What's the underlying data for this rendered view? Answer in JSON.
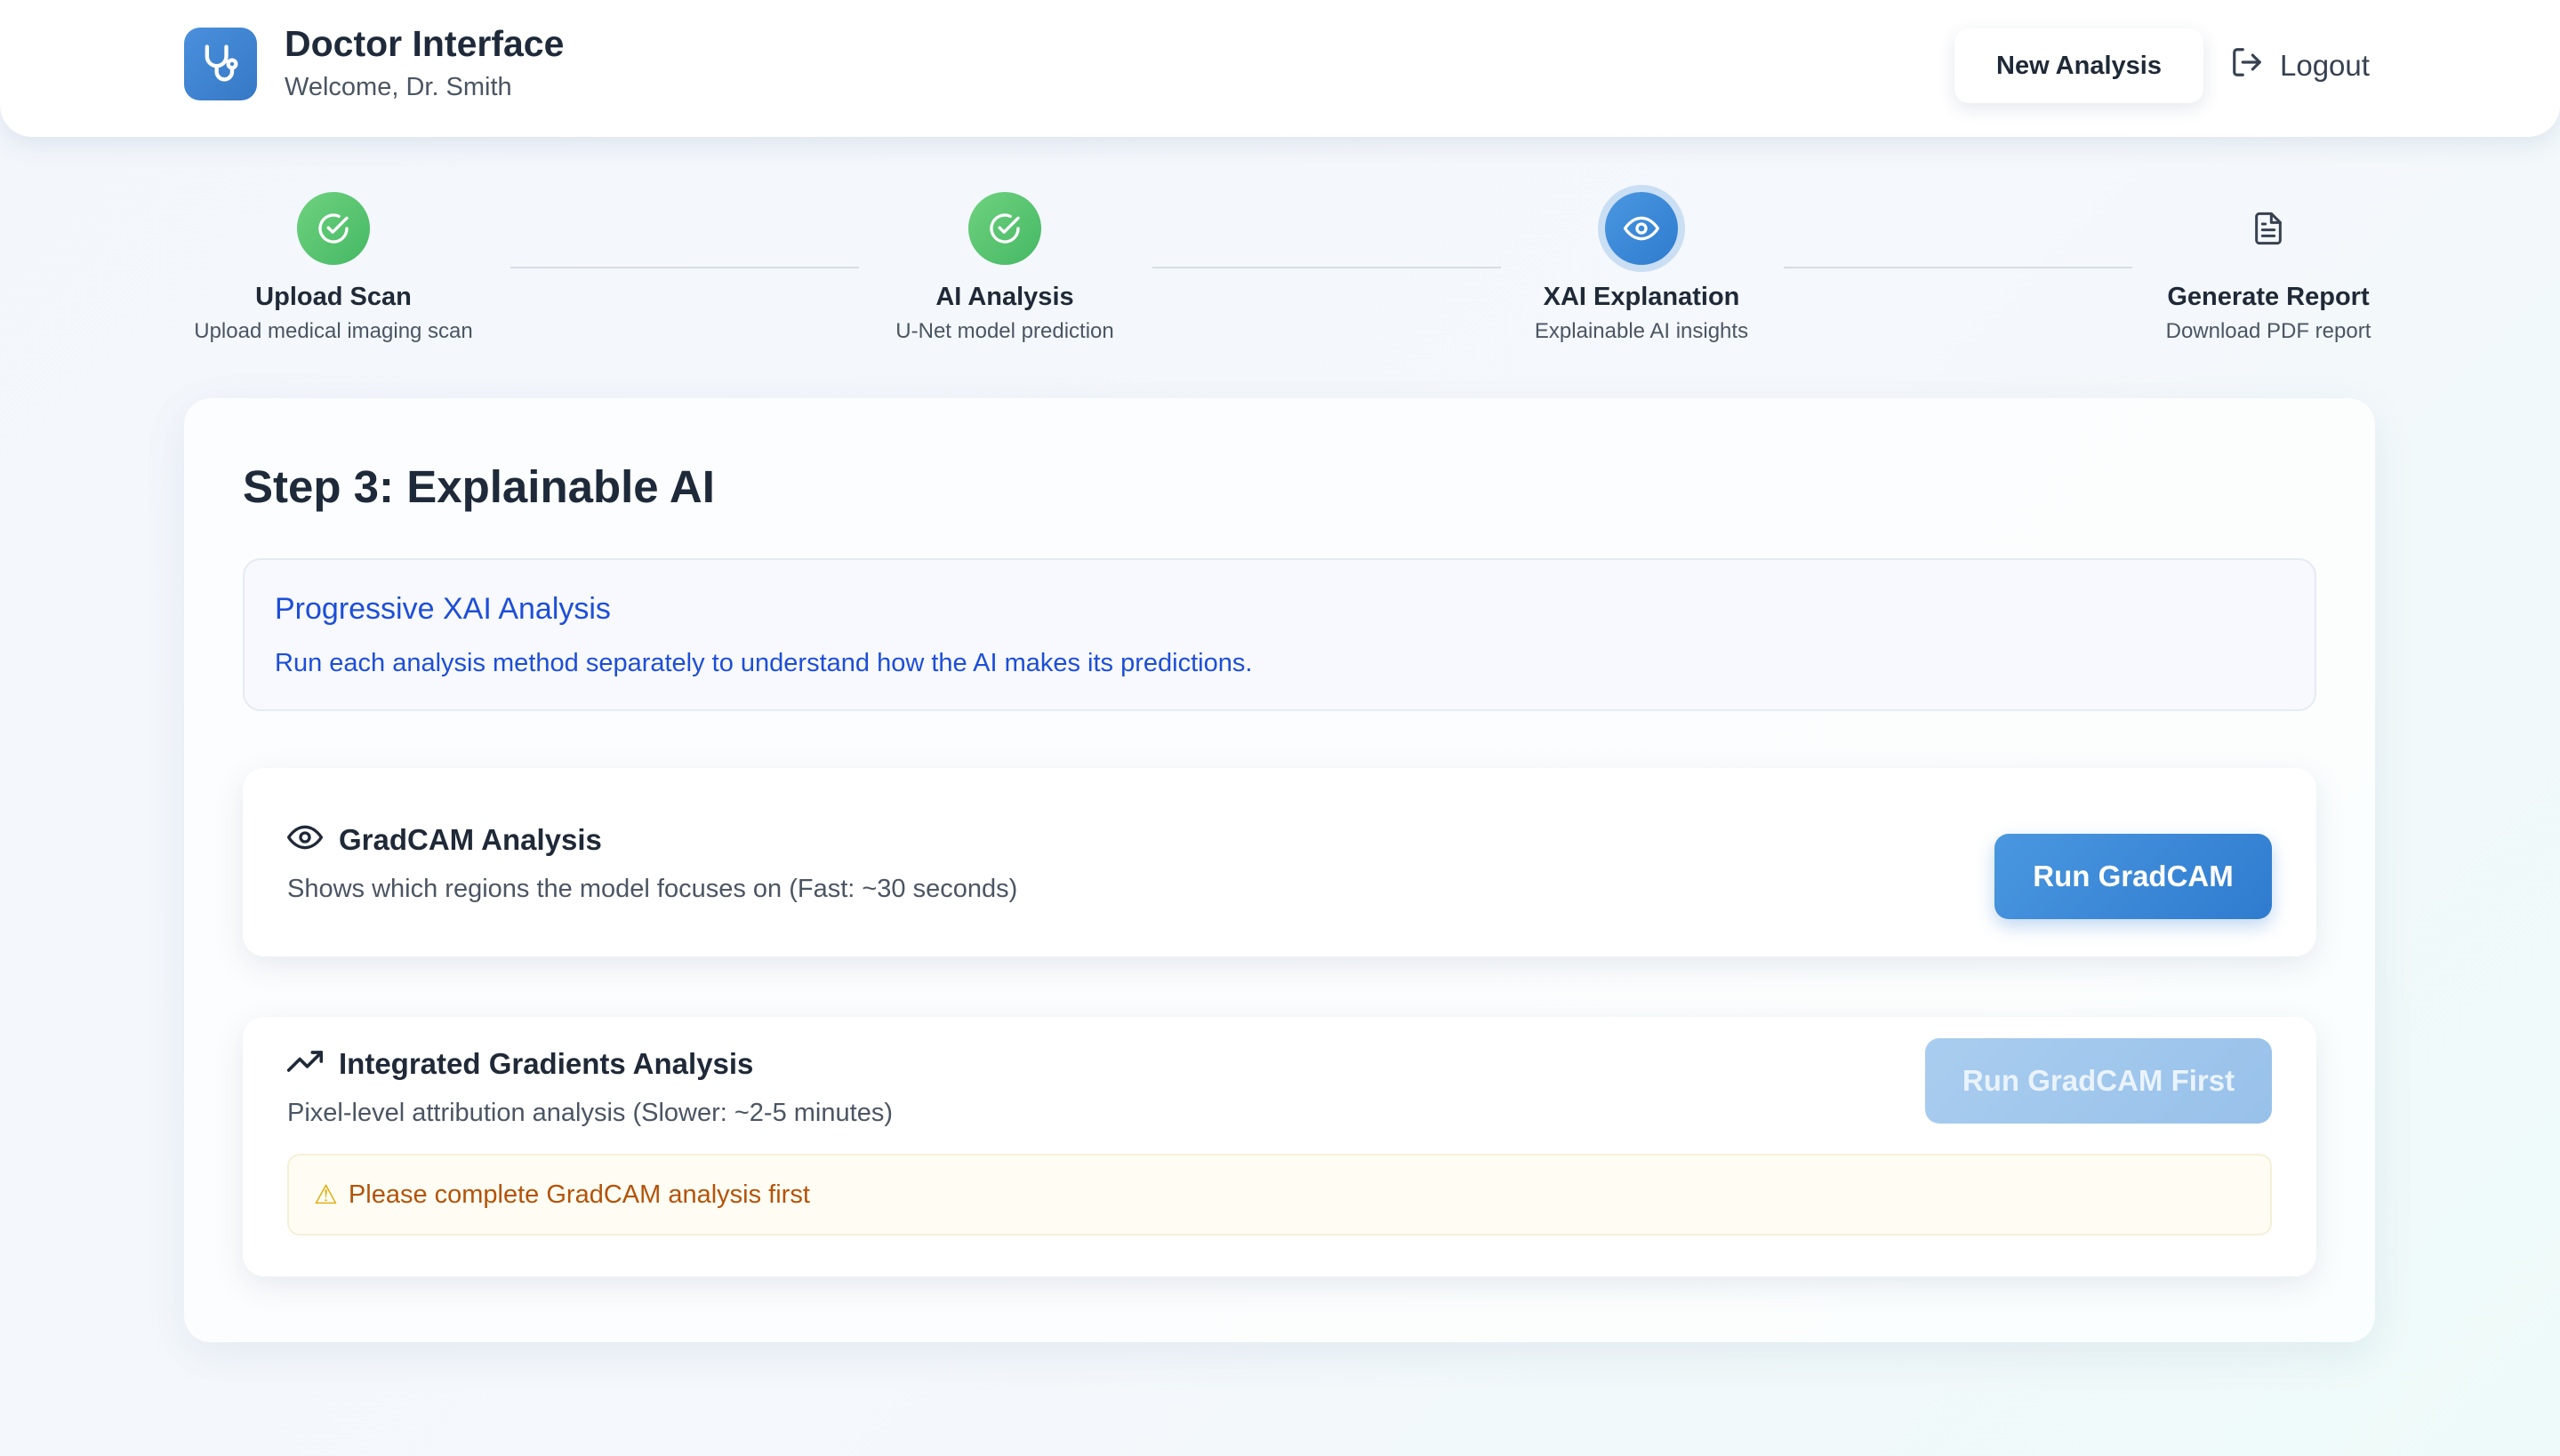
{
  "header": {
    "title": "Doctor Interface",
    "subtitle": "Welcome, Dr. Smith",
    "logo_icon": "stethoscope-icon",
    "new_analysis_label": "New Analysis",
    "logout_label": "Logout",
    "logout_icon": "logout-icon"
  },
  "stepper": {
    "steps": [
      {
        "label": "Upload Scan",
        "sublabel": "Upload medical imaging scan",
        "status": "completed",
        "icon": "check-circle-icon"
      },
      {
        "label": "AI Analysis",
        "sublabel": "U-Net model prediction",
        "status": "completed",
        "icon": "check-circle-icon"
      },
      {
        "label": "XAI Explanation",
        "sublabel": "Explainable AI insights",
        "status": "active",
        "icon": "eye-icon"
      },
      {
        "label": "Generate Report",
        "sublabel": "Download PDF report",
        "status": "pending",
        "icon": "document-icon"
      }
    ]
  },
  "main": {
    "title": "Step 3: Explainable AI",
    "info": {
      "title": "Progressive XAI Analysis",
      "text": "Run each analysis method separately to understand how the AI makes its predictions."
    },
    "methods": [
      {
        "title": "GradCAM Analysis",
        "description": "Shows which regions the model focuses on (Fast: ~30 seconds)",
        "icon": "eye-icon",
        "button_label": "Run GradCAM",
        "button_enabled": true
      },
      {
        "title": "Integrated Gradients Analysis",
        "description": "Pixel-level attribution analysis (Slower: ~2-5 minutes)",
        "icon": "trending-up-icon",
        "button_label": "Run GradCAM First",
        "button_enabled": false,
        "warning": "Please complete GradCAM analysis first"
      }
    ]
  },
  "colors": {
    "primary": "#3b86d6",
    "success": "#52c46f",
    "info_text": "#1d4ed8",
    "warning_text": "#b45309"
  }
}
